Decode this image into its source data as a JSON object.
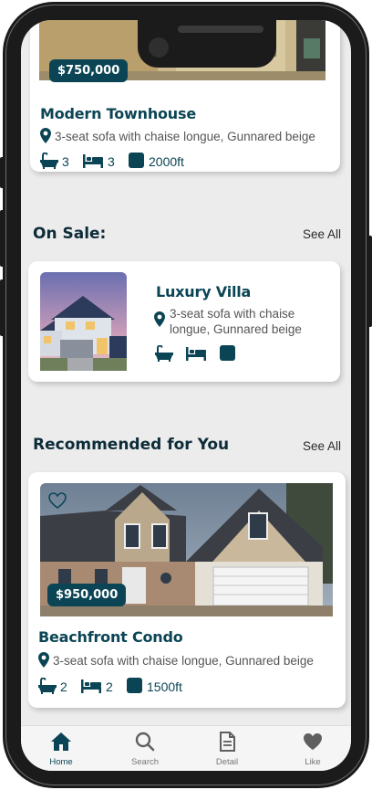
{
  "listings_top": {
    "price": "$750,000",
    "title": "Modern Townhouse",
    "address": "3-seat sofa with chaise longue, Gunnared beige",
    "baths": "3",
    "beds": "3",
    "area": "2000ft"
  },
  "on_sale": {
    "heading": "On Sale:",
    "see_all": "See All",
    "item": {
      "title": "Luxury Villa",
      "address": "3-seat sofa with chaise longue, Gunnared beige"
    }
  },
  "recommended": {
    "heading": "Recommended for You",
    "see_all": "See All",
    "item": {
      "price": "$950,000",
      "title": "Beachfront Condo",
      "address": "3-seat sofa with chaise longue, Gunnared beige",
      "baths": "2",
      "beds": "2",
      "area": "1500ft"
    }
  },
  "nav": {
    "items": [
      {
        "label": "Home",
        "icon": "home-icon",
        "active": true
      },
      {
        "label": "Search",
        "icon": "search-icon",
        "active": false
      },
      {
        "label": "Detail",
        "icon": "document-icon",
        "active": false
      },
      {
        "label": "Like",
        "icon": "heart-icon",
        "active": false
      }
    ]
  },
  "colors": {
    "brand": "#0b4555",
    "background": "#ececec",
    "card": "#ffffff"
  }
}
